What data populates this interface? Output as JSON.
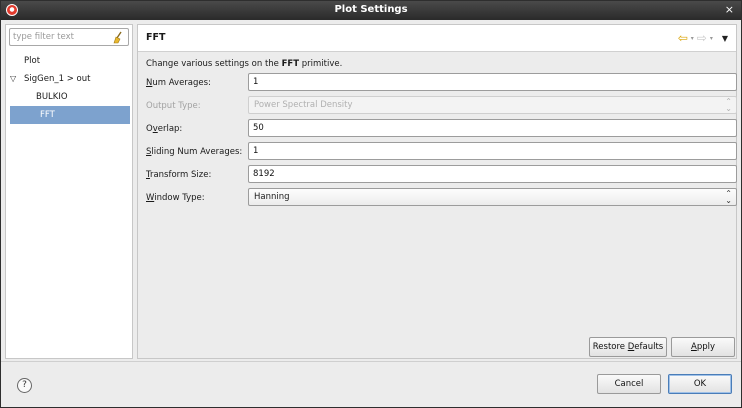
{
  "window": {
    "title": "Plot Settings",
    "close_glyph": "×"
  },
  "filter": {
    "placeholder": "type filter text",
    "icon": "clear-filter-icon"
  },
  "tree": {
    "items": [
      {
        "label": "Plot"
      },
      {
        "label": "SigGen_1 > out",
        "toggle": "▽"
      },
      {
        "label": "BULKIO"
      },
      {
        "label": "FFT"
      }
    ]
  },
  "page": {
    "title": "FFT",
    "description_prefix": "Change various settings on the ",
    "description_bold": "FFT",
    "description_suffix": " primitive.",
    "nav": {
      "back_glyph": "⇦",
      "forward_glyph": "⇨",
      "caret": "▾",
      "menu_glyph": "▼"
    }
  },
  "fields": {
    "num_averages": {
      "label_accel": "N",
      "label_rest": "um Averages:",
      "value": "1"
    },
    "output_type": {
      "label": "Output Type:",
      "value": "Power Spectral Density",
      "disabled": true
    },
    "overlap": {
      "label_pre": "O",
      "label_accel": "v",
      "label_rest": "erlap:",
      "value": "50"
    },
    "sliding_num_averages": {
      "label_accel": "S",
      "label_rest": "liding Num Averages:",
      "value": "1"
    },
    "transform_size": {
      "label_accel": "T",
      "label_rest": "ransform Size:",
      "value": "8192"
    },
    "window_type": {
      "label_accel": "W",
      "label_rest": "indow Type:",
      "value": "Hanning"
    }
  },
  "buttons": {
    "restore_defaults": {
      "pre": "Restore ",
      "accel": "D",
      "rest": "efaults"
    },
    "apply": {
      "accel": "A",
      "rest": "pply"
    },
    "cancel": "Cancel",
    "ok": "OK",
    "help": "?"
  },
  "colors": {
    "selection": "#7da2ce",
    "nav_arrow": "#d9a200",
    "titlebar": "#2e2e2e"
  }
}
